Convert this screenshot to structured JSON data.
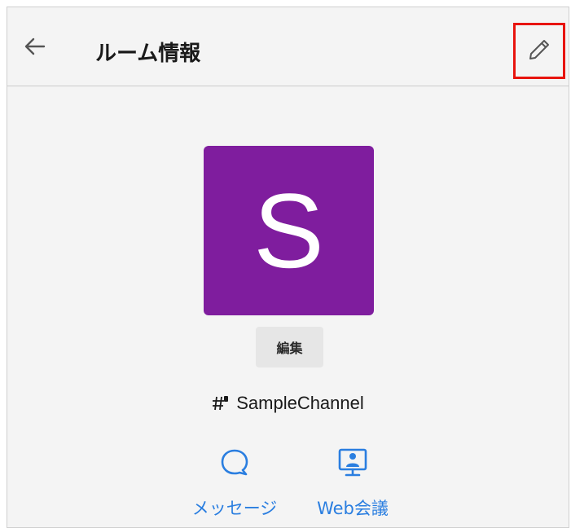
{
  "header": {
    "title": "ルーム情報",
    "back_icon": "arrow-left-icon",
    "edit_icon": "pencil-icon",
    "highlight_color": "#e8140e"
  },
  "room": {
    "avatar_letter": "S",
    "avatar_color": "#7f1d9e",
    "edit_label": "編集",
    "channel_icon": "channel-hash-icon",
    "channel_name": "SampleChannel"
  },
  "actions": [
    {
      "label": "メッセージ",
      "icon": "chat-bubble-icon"
    },
    {
      "label": "Web会議",
      "icon": "video-conference-icon"
    }
  ],
  "colors": {
    "accent": "#2a7ee0",
    "background": "#f4f4f4"
  }
}
